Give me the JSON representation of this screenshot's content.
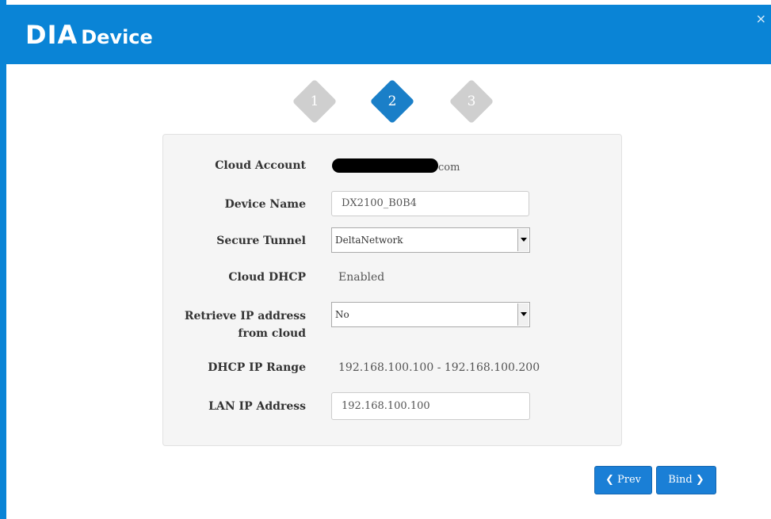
{
  "header": {
    "logo_big": "DIA",
    "logo_small": "Device",
    "close_icon": "×",
    "color": "#0a84d6"
  },
  "steps": [
    {
      "label": "1",
      "state": "inactive"
    },
    {
      "label": "2",
      "state": "active"
    },
    {
      "label": "3",
      "state": "inactive"
    }
  ],
  "form": {
    "cloud_account": {
      "label": "Cloud Account",
      "suffix": "com"
    },
    "device_name": {
      "label": "Device Name",
      "value": "DX2100_B0B4"
    },
    "secure_tunnel": {
      "label": "Secure Tunnel",
      "value": "DeltaNetwork"
    },
    "cloud_dhcp": {
      "label": "Cloud DHCP",
      "value": "Enabled"
    },
    "retrieve_ip": {
      "label_line1": "Retrieve IP address",
      "label_line2": "from cloud",
      "value": "No"
    },
    "dhcp_range": {
      "label": "DHCP IP Range",
      "value": "192.168.100.100 - 192.168.100.200"
    },
    "lan_ip": {
      "label": "LAN IP Address",
      "value": "192.168.100.100"
    }
  },
  "buttons": {
    "prev": {
      "icon": "chevron-left-icon",
      "label": "Prev"
    },
    "bind": {
      "label": "Bind",
      "icon": "chevron-right-icon"
    },
    "color": "#1a7fd6"
  }
}
